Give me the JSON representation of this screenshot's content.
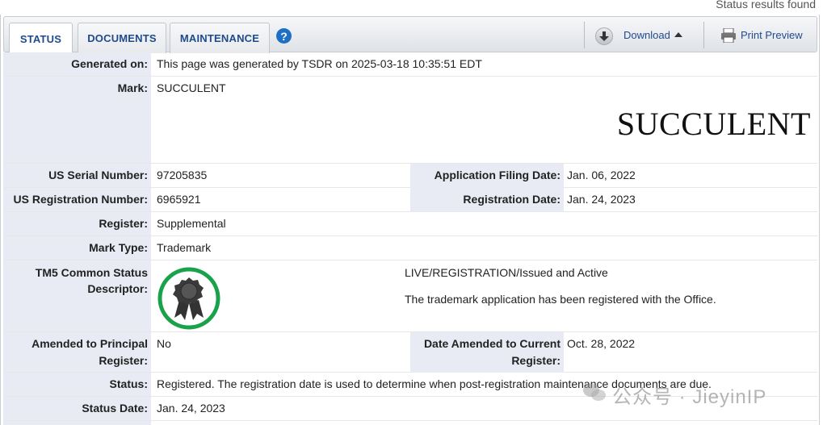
{
  "header": {
    "results_found": "Status results found"
  },
  "tabs": [
    {
      "label": "STATUS",
      "active": true
    },
    {
      "label": "DOCUMENTS",
      "active": false
    },
    {
      "label": "MAINTENANCE",
      "active": false
    }
  ],
  "toolbar": {
    "help_label": "?",
    "download_label": "Download",
    "print_label": "Print Preview"
  },
  "fields": {
    "generated_on": {
      "label": "Generated on:",
      "value": "This page was generated by TSDR on 2025-03-18 10:35:51 EDT"
    },
    "mark": {
      "label": "Mark:",
      "value": "SUCCULENT",
      "image_text": "SUCCULENT"
    },
    "serial": {
      "label": "US Serial Number:",
      "value": "97205835"
    },
    "filing_date": {
      "label": "Application Filing Date:",
      "value": "Jan. 06, 2022"
    },
    "reg_number": {
      "label": "US Registration Number:",
      "value": "6965921"
    },
    "reg_date": {
      "label": "Registration Date:",
      "value": "Jan. 24, 2023"
    },
    "register": {
      "label": "Register:",
      "value": "Supplemental"
    },
    "mark_type": {
      "label": "Mark Type:",
      "value": "Trademark"
    },
    "tm5": {
      "label_line1": "TM5 Common Status",
      "label_line2": "Descriptor:",
      "status_line": "LIVE/REGISTRATION/Issued and Active",
      "description": "The trademark application has been registered with the Office.",
      "badge_icon": "award-ribbon-icon",
      "badge_color": "#1aa24a"
    },
    "amended_principal": {
      "label_line1": "Amended to Principal",
      "label_line2": "Register:",
      "value": "No"
    },
    "date_amended": {
      "label_line1": "Date Amended to Current",
      "label_line2": "Register:",
      "value": "Oct. 28, 2022"
    },
    "status": {
      "label": "Status:",
      "value": "Registered. The registration date is used to determine when post-registration maintenance documents are due."
    },
    "status_date": {
      "label": "Status Date:",
      "value": "Jan. 24, 2023"
    }
  },
  "watermark": {
    "text": "公众号 · JieyinIP"
  },
  "colors": {
    "accent": "#1f4b8c",
    "label_bg": "#e8eaf4",
    "help": "#1f6fc4"
  }
}
